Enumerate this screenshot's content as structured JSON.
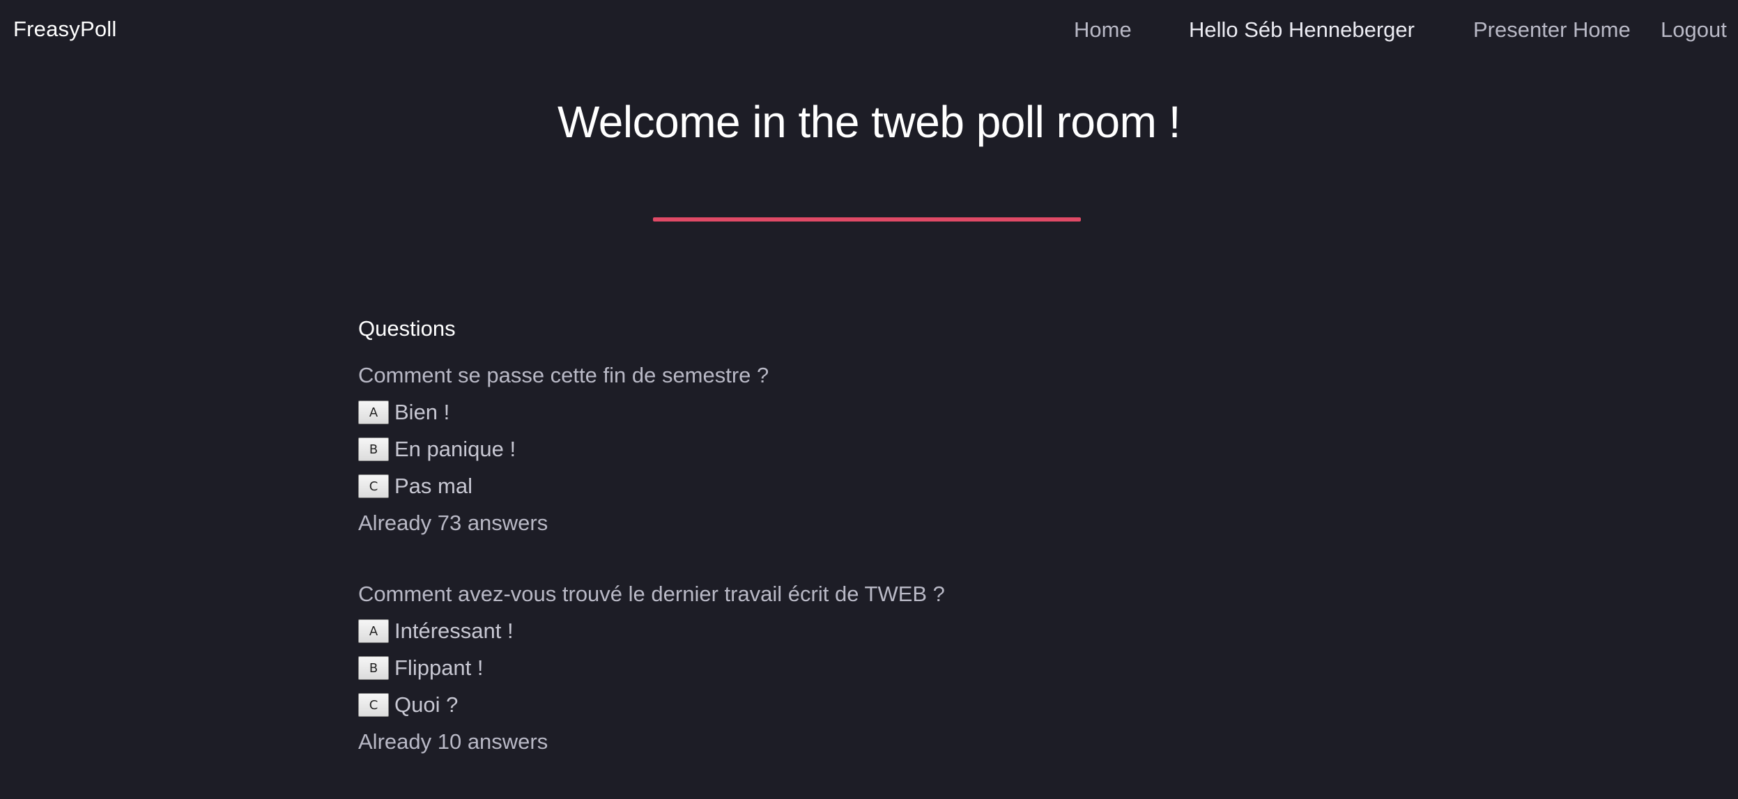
{
  "header": {
    "brand": "FreasyPoll",
    "nav": {
      "home": "Home",
      "greeting": "Hello Séb Henneberger",
      "presenter_home": "Presenter Home",
      "logout": "Logout"
    }
  },
  "hero": {
    "title": "Welcome in the tweb poll room !",
    "accent_color": "#e04a66"
  },
  "main": {
    "section_title": "Questions",
    "questions": [
      {
        "text": "Comment se passe cette fin de semestre ?",
        "answers": [
          {
            "key": "A",
            "label": "Bien !"
          },
          {
            "key": "B",
            "label": "En panique !"
          },
          {
            "key": "C",
            "label": "Pas mal"
          }
        ],
        "count_text": "Already 73 answers"
      },
      {
        "text": "Comment avez-vous trouvé le dernier travail écrit de TWEB ?",
        "answers": [
          {
            "key": "A",
            "label": "Intéressant !"
          },
          {
            "key": "B",
            "label": "Flippant !"
          },
          {
            "key": "C",
            "label": "Quoi ?"
          }
        ],
        "count_text": "Already 10 answers"
      }
    ]
  },
  "colors": {
    "background": "#1d1d26",
    "accent": "#e04a66"
  }
}
